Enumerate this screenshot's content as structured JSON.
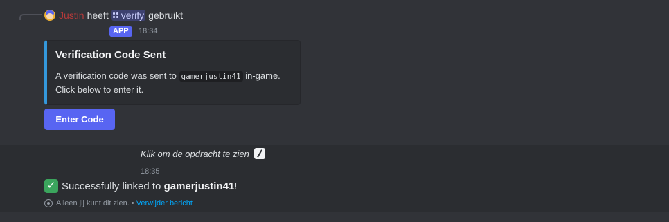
{
  "reply": {
    "username": "Justin",
    "verb_before": "heeft",
    "command": "verify",
    "verb_after": "gebruikt"
  },
  "message": {
    "app_tag": "APP",
    "timestamp": "18:34",
    "embed": {
      "title": "Verification Code Sent",
      "desc_before": "A verification code was sent to",
      "desc_code": "gamerjustin41",
      "desc_after": "in-game.",
      "desc_line2": "Click below to enter it.",
      "border_color": "#3498db"
    },
    "button_label": "Enter Code"
  },
  "followup": {
    "prompt_text": "Klik om de opdracht te zien",
    "timestamp": "18:35",
    "success_prefix": "Successfully linked to",
    "success_name": "gamerjustin41",
    "success_suffix": "!",
    "ephemeral_text": "Alleen jij kunt dit zien.",
    "separator": "•",
    "dismiss_label": "Verwijder bericht"
  },
  "colors": {
    "background": "#313338",
    "ephemeral_background": "#2b2d31",
    "accent": "#5865f2",
    "username": "#b53a3a",
    "link": "#00a8fc"
  },
  "icons": {
    "avatar": "user-avatar",
    "command": "slash-command-icon",
    "prompt": "pencil-icon",
    "success": "check-mark-icon",
    "ephemeral": "eye-icon"
  }
}
